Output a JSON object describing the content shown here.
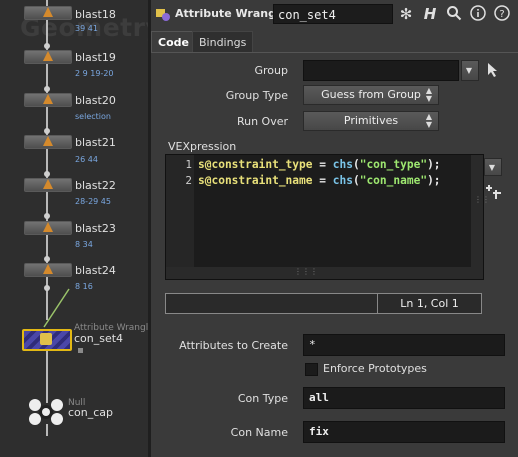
{
  "network": {
    "watermark": "Geometry",
    "nodes": [
      {
        "name": "blast18",
        "group": "39 41"
      },
      {
        "name": "blast19",
        "group": "2 9 19-20"
      },
      {
        "name": "blast20",
        "group": "selection"
      },
      {
        "name": "blast21",
        "group": "26 44"
      },
      {
        "name": "blast22",
        "group": "28-29 45"
      },
      {
        "name": "blast23",
        "group": "8 34"
      },
      {
        "name": "blast24",
        "group": "8 16"
      }
    ],
    "wrangle_node": {
      "type": "Attribute Wrangle",
      "name": "con_set4"
    },
    "null_node": {
      "type": "Null",
      "name": "con_cap"
    }
  },
  "header": {
    "operator_type": "Attribute Wrangle",
    "node_name": "con_set4",
    "icons": [
      "gear-icon",
      "help-h-icon",
      "search-icon",
      "info-icon",
      "help-icon"
    ]
  },
  "tabs": [
    {
      "label": "Code",
      "active": true
    },
    {
      "label": "Bindings",
      "active": false
    }
  ],
  "params": {
    "group": {
      "label": "Group",
      "value": ""
    },
    "group_type": {
      "label": "Group Type",
      "value": "Guess from Group"
    },
    "run_over": {
      "label": "Run Over",
      "value": "Primitives"
    },
    "vexpression_label": "VEXpression",
    "code_lines": [
      {
        "num": "1",
        "attr": "s@constraint_type",
        "op": " = ",
        "fn": "chs",
        "open": "(",
        "str": "\"con_type\"",
        "close": ");"
      },
      {
        "num": "2",
        "attr": "s@constraint_name",
        "op": " = ",
        "fn": "chs",
        "open": "(",
        "str": "\"con_name\"",
        "close": ");"
      }
    ],
    "cursor_status": "Ln 1, Col 1",
    "attributes_to_create": {
      "label": "Attributes to Create",
      "value": "*"
    },
    "enforce_prototypes": {
      "label": "Enforce Prototypes",
      "checked": false
    },
    "con_type": {
      "label": "Con Type",
      "value": "all"
    },
    "con_name": {
      "label": "Con Name",
      "value": "fix"
    }
  },
  "colors": {
    "accent_selected": "#e2b814",
    "wrangle_node": "#4a47a8",
    "group_text": "#7aa7e0",
    "code_attribute": "#e8e07a",
    "code_function": "#7ac4e8",
    "code_string": "#9ee870"
  }
}
